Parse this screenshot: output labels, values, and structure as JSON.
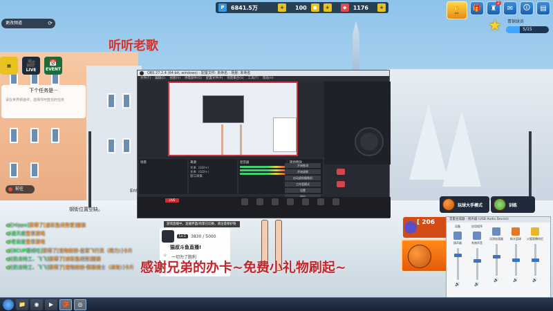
{
  "hud": {
    "currency_badge": "P",
    "currency_value": "6841.5万",
    "gold_value": "100",
    "gem_value": "1176",
    "icons": [
      "menu-icon",
      "gift-icon",
      "mail-icon",
      "notice-icon",
      "settings-icon"
    ],
    "mail_count": "2",
    "rank_label": "青铜球员",
    "rank_progress": "5/15",
    "rank_progress_fraction": 0.33
  },
  "left": {
    "channel_label": "更改频道",
    "overlay_title": "听听老歌",
    "mini_icons": [
      {
        "name": "calendar",
        "label": ""
      },
      {
        "name": "live",
        "label": "LIVE"
      },
      {
        "name": "event",
        "label": "EVENT"
      }
    ],
    "task_title": "下个任务是···",
    "task_desc": "请在世界频道中，选择你可胜任的任务",
    "go_button": "前往",
    "location_text": "钢街位置空缺。",
    "ent_text": "Ent"
  },
  "chat": [
    {
      "speaker": "",
      "prefix": "[Hippo]",
      "text": "获得了[速彩急闭劳爱]服装"
    },
    {
      "speaker": "",
      "prefix": "通天痕",
      "text": "登录游戏"
    },
    {
      "speaker": "",
      "prefix": "老自是",
      "text": "登录游戏"
    },
    {
      "speaker": "",
      "prefix": "[BCUP最倾吃]",
      "text": "获得了[宠物扮扮-星家飞行员（限力）]卡片"
    },
    {
      "speaker": "",
      "prefix": "[奶龙特工、飞飞]",
      "text": "获得了[述彩急闭劳]服装"
    },
    {
      "speaker": "",
      "prefix": "[奶龙特工、飞飞]",
      "text": "获得了[宠物扮扮-假装骑士（进攻）]卡片"
    }
  ],
  "obs": {
    "title": "OBS 27.2.4 (64-bit, windows) - 配置文件: 未命名 - 场景: 未命名",
    "menu": [
      "文件(F)",
      "编辑(E)",
      "视图(V)",
      "停靠部件(D)",
      "配置文件(P)",
      "场景集合(S)",
      "工具(T)",
      "帮助(H)"
    ],
    "docks": {
      "scenes_header": "场景",
      "sources_header": "来源",
      "sources": [
        "文本（GDI+）",
        "文本（GDI+）",
        "窗口采集"
      ],
      "mixer_header": "混音器",
      "transitions_header": "转场特效",
      "controls": [
        "开始推流",
        "开始录制",
        "启动虚拟摄像机",
        "工作室模式",
        "设置",
        "退出"
      ]
    },
    "status_live": "LIVE",
    "status_text": "00:00:00"
  },
  "popup": {
    "dialog_text": "游戏直播中，直播界面/场景已切换，请注意保护隐私！",
    "level": "Lv.1",
    "name": "猫叔斗鱼直播!",
    "sub": "一切为了胜利",
    "progress": "3830 / 5000"
  },
  "caption": "感谢兄弟的办卡~免费小礼物刷起~",
  "game": {
    "mode1_label": "玩球大手模式",
    "mode2_label": "训练",
    "score_prefix": "[",
    "score_value": "206"
  },
  "volume_mixer": {
    "title": "音量合成器 - 扬声器 (USB Audio Device)",
    "columns": [
      {
        "label": "设备",
        "sub": "扬声器"
      },
      {
        "label": "应用程序",
        "sub": "系统声音"
      },
      {
        "label": "",
        "sub": "迅游加速器"
      },
      {
        "label": "",
        "sub": "街头篮球"
      },
      {
        "label": "",
        "sub": "火狐直播伴侣"
      }
    ],
    "levels": [
      0.8,
      0.6,
      0.6,
      0.5,
      0.5
    ]
  },
  "taskbar": {
    "apps": [
      "folder-icon",
      "browser-icon",
      "media-icon",
      "game-icon",
      "obs-icon"
    ],
    "clock_time": "",
    "clock_date": ""
  }
}
